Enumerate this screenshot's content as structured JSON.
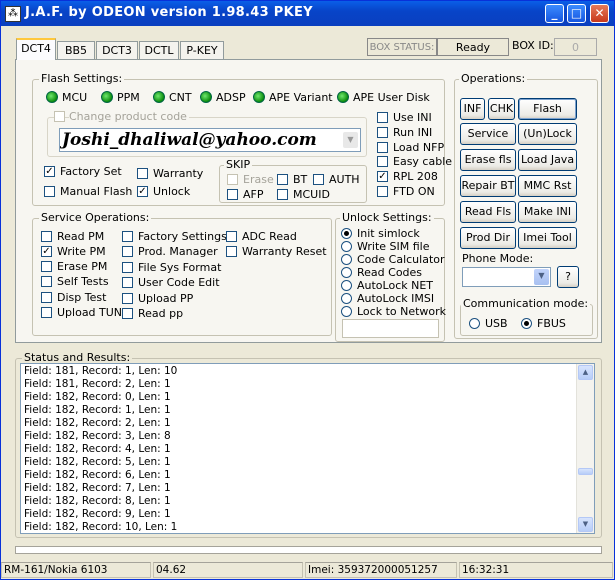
{
  "window": {
    "title": "J.A.F. by ODEON version 1.98.43 PKEY",
    "icon": "jaf-app-icon",
    "minimize": "_",
    "maximize": "□",
    "close": "✕"
  },
  "tabs": [
    "DCT4",
    "BB5",
    "DCT3",
    "DCTL",
    "P-KEY"
  ],
  "box_status": {
    "label": "BOX STATUS:",
    "value": "Ready",
    "id_label": "BOX ID:",
    "id_value": "0"
  },
  "flash_settings": {
    "legend": "Flash Settings:",
    "leds": [
      "MCU",
      "PPM",
      "CNT",
      "ADSP",
      "APE Variant",
      "APE User Disk"
    ],
    "change_product_code": "Change product code",
    "product_code_value": "Joshi_dhaliwal@yahoo.com",
    "right_checks": [
      {
        "label": "Use INI",
        "checked": false
      },
      {
        "label": "Run INI",
        "checked": false
      },
      {
        "label": "Load NFP",
        "checked": false
      },
      {
        "label": "Easy cable",
        "checked": false
      },
      {
        "label": "RPL 208",
        "checked": true
      },
      {
        "label": "FTD ON",
        "checked": false
      }
    ],
    "factory_set": "Factory Set",
    "warranty": "Warranty",
    "manual_flash": "Manual Flash",
    "unlock": "Unlock",
    "skip_legend": "SKIP",
    "skip": {
      "erase": "Erase",
      "bt": "BT",
      "auth": "AUTH",
      "afp": "AFP",
      "mcuid": "MCUID"
    }
  },
  "service_operations": {
    "legend": "Service Operations:",
    "col1": [
      {
        "label": "Read PM",
        "checked": false
      },
      {
        "label": "Write PM",
        "checked": true
      },
      {
        "label": "Erase PM",
        "checked": false
      },
      {
        "label": "Self Tests",
        "checked": false
      },
      {
        "label": "Disp Test",
        "checked": false
      },
      {
        "label": "Upload TUN",
        "checked": false
      }
    ],
    "col2": [
      {
        "label": "Factory Settings",
        "checked": false
      },
      {
        "label": "Prod. Manager",
        "checked": false
      },
      {
        "label": "File Sys Format",
        "checked": false
      },
      {
        "label": "User Code Edit",
        "checked": false
      },
      {
        "label": "Upload PP",
        "checked": false
      },
      {
        "label": "Read pp",
        "checked": false
      }
    ],
    "col3": [
      {
        "label": "ADC Read",
        "checked": false
      },
      {
        "label": "Warranty Reset",
        "checked": false
      }
    ]
  },
  "unlock_settings": {
    "legend": "Unlock Settings:",
    "options": [
      "Init simlock",
      "Write SIM file",
      "Code Calculator",
      "Read Codes",
      "AutoLock NET",
      "AutoLock IMSI",
      "Lock to Network"
    ],
    "selected": 0
  },
  "operations": {
    "legend": "Operations:",
    "buttons": [
      [
        "INF",
        "CHK",
        "Flash"
      ],
      [
        "Service",
        "(Un)Lock"
      ],
      [
        "Erase fls",
        "Load Java"
      ],
      [
        "Repair BT",
        "MMC Rst"
      ],
      [
        "Read Fls",
        "Make INI"
      ],
      [
        "Prod Dir",
        "Imei Tool"
      ]
    ],
    "phone_mode_label": "Phone Mode:",
    "phone_mode_help": "?",
    "comm_legend": "Communication mode:",
    "comm_usb": "USB",
    "comm_fbus": "FBUS",
    "comm_selected": "FBUS"
  },
  "status": {
    "legend": "Status and Results:",
    "lines": [
      "Field: 181, Record: 1, Len: 10",
      "Field: 181, Record: 2, Len: 1",
      "Field: 182, Record: 0, Len: 1",
      "Field: 182, Record: 1, Len: 1",
      "Field: 182, Record: 2, Len: 1",
      "Field: 182, Record: 3, Len: 8",
      "Field: 182, Record: 4, Len: 1",
      "Field: 182, Record: 5, Len: 1",
      "Field: 182, Record: 6, Len: 1",
      "Field: 182, Record: 7, Len: 1",
      "Field: 182, Record: 8, Len: 1",
      "Field: 182, Record: 9, Len: 1",
      "Field: 182, Record: 10, Len: 1"
    ]
  },
  "statusbar": {
    "model": "RM-161/Nokia 6103",
    "version": "04.62",
    "imei": "Imei: 359372000051257",
    "time": "16:32:31"
  }
}
